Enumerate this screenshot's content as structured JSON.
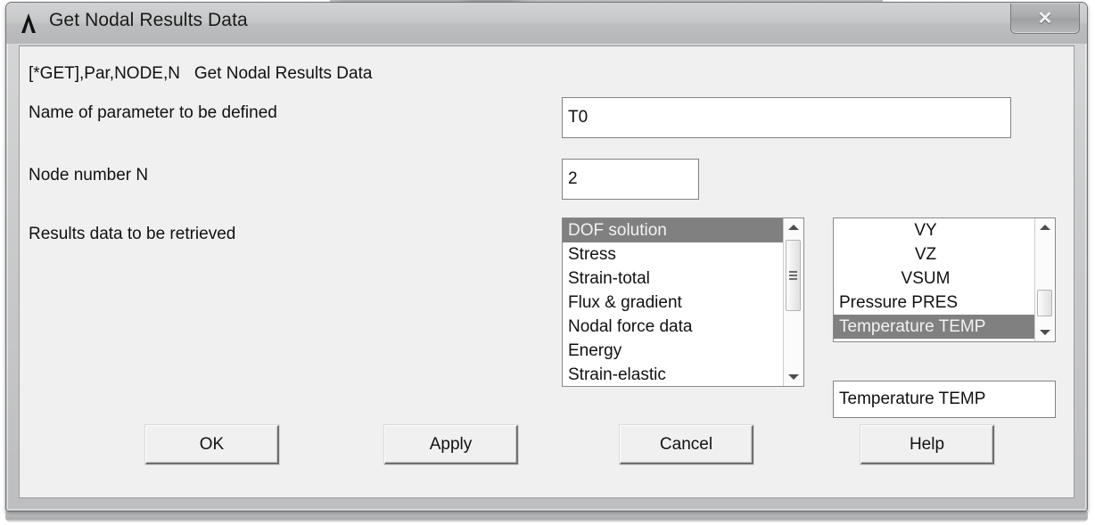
{
  "window": {
    "title": "Get Nodal Results Data",
    "icon": "ansys-lambda-icon",
    "close_label": "✕"
  },
  "dialog": {
    "command_header": "[*GET],Par,NODE,N   Get Nodal Results Data",
    "labels": {
      "parameter_name": "Name of parameter to be defined",
      "node_number": "Node number N",
      "results_data": "Results data to be retrieved"
    },
    "fields": {
      "parameter_name": {
        "value": "T0",
        "placeholder": ""
      },
      "node_number": {
        "value": "2",
        "placeholder": ""
      },
      "selected_result": {
        "value": "Temperature TEMP",
        "placeholder": ""
      }
    },
    "category_list": {
      "items": [
        "DOF solution",
        "Stress",
        "Strain-total",
        "Flux & gradient",
        "Nodal force data",
        "Energy",
        "Strain-elastic"
      ],
      "selected_index": 0
    },
    "component_list": {
      "items": [
        "VY",
        "VZ",
        "VSUM",
        "Pressure   PRES",
        "Temperature TEMP"
      ],
      "selected_index": 4,
      "centered_indices": [
        0,
        1,
        2
      ]
    },
    "buttons": {
      "ok": "OK",
      "apply": "Apply",
      "cancel": "Cancel",
      "help": "Help"
    }
  },
  "colors": {
    "selection": "#808080",
    "selection_text": "#f2f2f2",
    "dialog_bg": "#f0f0f0",
    "titlebar": "#c6c7c8",
    "text": "#111111"
  }
}
